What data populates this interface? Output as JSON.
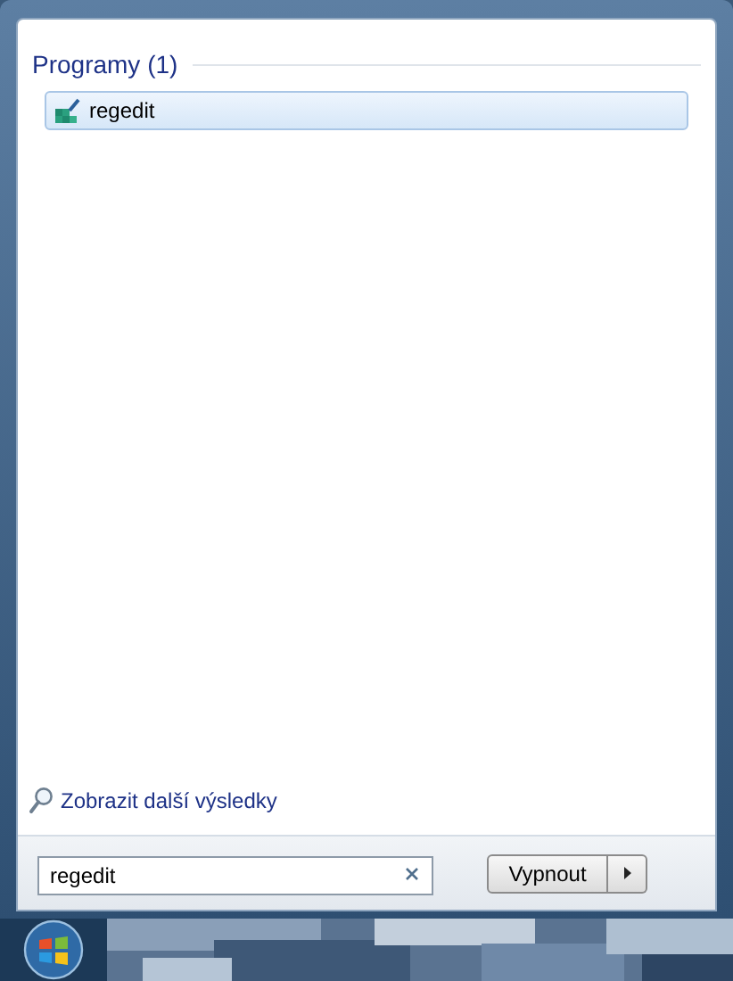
{
  "results": {
    "group_title": "Programy (1)",
    "items": [
      {
        "label": "regedit",
        "selected": true
      }
    ]
  },
  "more_results": "Zobrazit další výsledky",
  "search": {
    "value": "regedit"
  },
  "shutdown": {
    "label": "Vypnout"
  }
}
